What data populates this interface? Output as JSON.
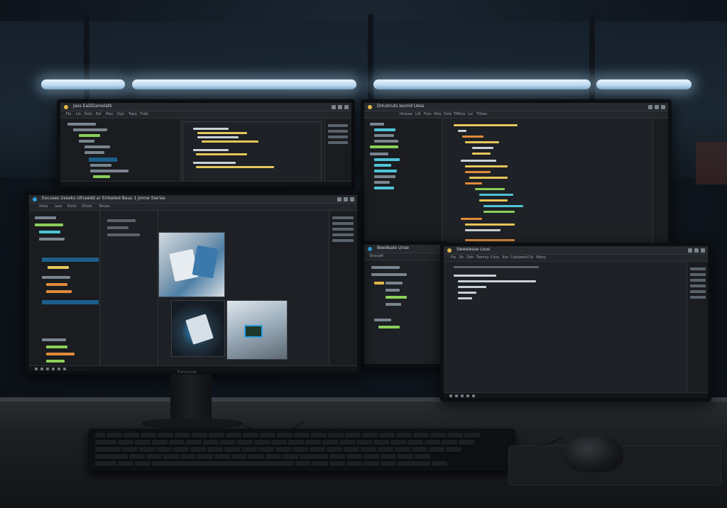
{
  "scene": {
    "description_domain": "multi-monitor desk setup with dark IDE windows"
  },
  "monitors": {
    "top_left": {
      "title": "Jass EaDDamelatk",
      "menu": [
        "Fle",
        "Lis",
        "Esto",
        "Eel",
        "Plas",
        "Dyo",
        "Tepq",
        "Tnbs"
      ]
    },
    "top_right": {
      "title": "Dmutcuts Ieumd Uess",
      "menu": [
        "Iliniose",
        "Ltll",
        "Fsto",
        "Htia",
        "Dsto",
        "Tiffiice",
        "Lsi",
        "Ttloes"
      ]
    },
    "front": {
      "title": "Excuses Usseks Ultraedd ar Entseled Baus 1 Jonne Sierlas",
      "menu": [
        "Illsos",
        "Iase",
        "Eloto",
        "Dtlsid",
        "Toroas"
      ],
      "brand": "Fsticcsse"
    },
    "middle": {
      "title": "Beedeale Unse",
      "sub": "Bnouelt"
    },
    "right": {
      "title": "Sweeiesse Lous",
      "menu": [
        "Fie",
        "Pe",
        "Deir",
        "Toenny",
        "Coxy",
        "Xse",
        "Codowed",
        "Cfy",
        "Weoy"
      ]
    }
  },
  "colors": {
    "accent_blue": "#2f9fe0",
    "code_green": "#8bcf5a",
    "code_yellow": "#e6c65a",
    "code_cyan": "#4fc3d8",
    "code_orange": "#e08a3c",
    "code_white": "#c9d1d8"
  },
  "icons": [
    "app-icon",
    "window-controls-icon",
    "taskbar-icon",
    "folder-icon",
    "file-icon"
  ]
}
